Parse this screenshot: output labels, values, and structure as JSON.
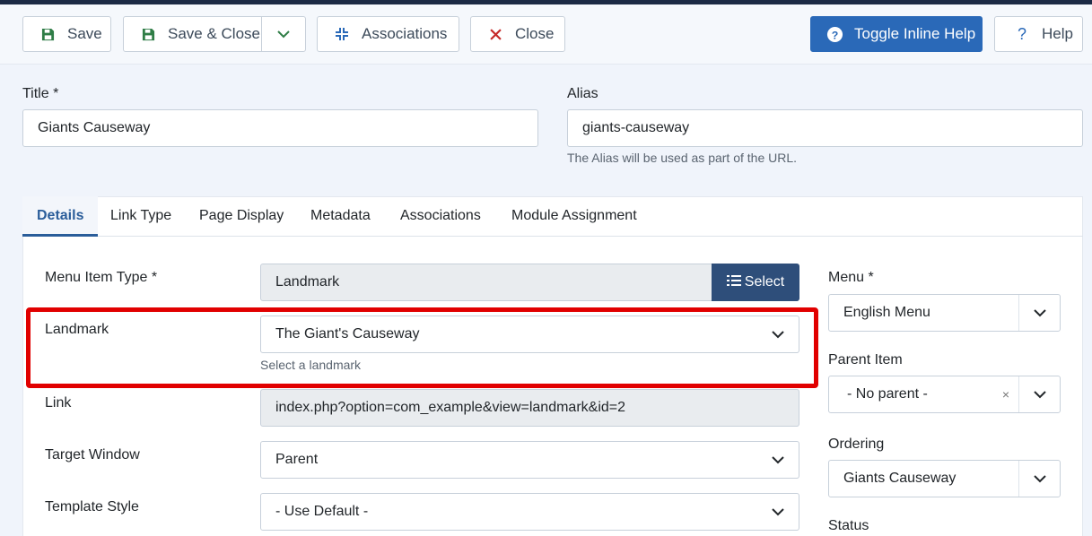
{
  "toolbar": {
    "save": "Save",
    "save_close": "Save & Close",
    "associations": "Associations",
    "close": "Close",
    "toggle_help": "Toggle Inline Help",
    "help": "Help"
  },
  "form": {
    "title_label": "Title *",
    "title_value": "Giants Causeway",
    "alias_label": "Alias",
    "alias_value": "giants-causeway",
    "alias_help": "The Alias will be used as part of the URL."
  },
  "tabs": [
    "Details",
    "Link Type",
    "Page Display",
    "Metadata",
    "Associations",
    "Module Assignment"
  ],
  "details": {
    "menu_item_type_label": "Menu Item Type *",
    "menu_item_type_value": "Landmark",
    "select_button": "Select",
    "landmark_label": "Landmark",
    "landmark_value": "The Giant's Causeway",
    "landmark_help": "Select a landmark",
    "link_label": "Link",
    "link_value": "index.php?option=com_example&view=landmark&id=2",
    "target_window_label": "Target Window",
    "target_window_value": "Parent",
    "template_style_label": "Template Style",
    "template_style_value": "- Use Default -"
  },
  "sidebar": {
    "menu_label": "Menu *",
    "menu_value": "English Menu",
    "parent_label": "Parent Item",
    "parent_value": "- No parent -",
    "parent_clear": "×",
    "ordering_label": "Ordering",
    "ordering_value": "Giants Causeway",
    "status_label": "Status"
  },
  "colors": {
    "primary": "#2a69b8",
    "select_button": "#2e4e7a",
    "highlight": "#e10000",
    "save_icon": "#2f7d46",
    "close_icon": "#c52827"
  },
  "icons": [
    "save-icon",
    "chevron-down-icon",
    "associations-icon",
    "close-icon",
    "question-circle-icon",
    "question-icon",
    "list-icon"
  ]
}
